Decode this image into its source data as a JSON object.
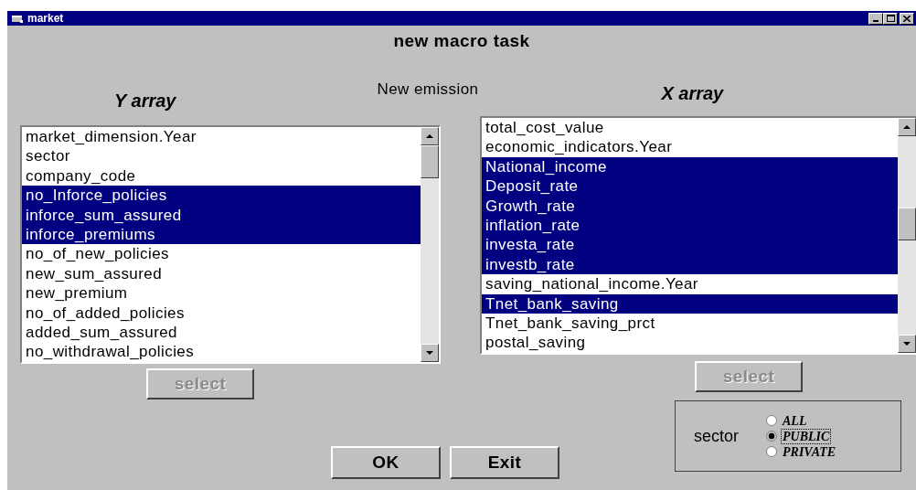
{
  "window": {
    "title": "market"
  },
  "heading": "new macro task",
  "y_array": {
    "label": "Y array",
    "select_button": {
      "label": "select",
      "disabled": true
    },
    "items": [
      {
        "label": "market_dimension.Year",
        "selected": false
      },
      {
        "label": "sector",
        "selected": false
      },
      {
        "label": "company_code",
        "selected": false
      },
      {
        "label": "no_Inforce_policies",
        "selected": true
      },
      {
        "label": "inforce_sum_assured",
        "selected": true
      },
      {
        "label": "inforce_premiums",
        "selected": true
      },
      {
        "label": "no_of_new_policies",
        "selected": false
      },
      {
        "label": "new_sum_assured",
        "selected": false
      },
      {
        "label": "new_premium",
        "selected": false
      },
      {
        "label": "no_of_added_policies",
        "selected": false
      },
      {
        "label": "added_sum_assured",
        "selected": false
      },
      {
        "label": "no_withdrawal_policies",
        "selected": false
      }
    ]
  },
  "new_emission_label": "New emission",
  "x_array": {
    "label": "X array",
    "select_button": {
      "label": "select",
      "disabled": true
    },
    "items": [
      {
        "label": "total_cost_value",
        "selected": false
      },
      {
        "label": "economic_indicators.Year",
        "selected": false
      },
      {
        "label": "National_income",
        "selected": true
      },
      {
        "label": "Deposit_rate",
        "selected": true
      },
      {
        "label": "Growth_rate",
        "selected": true
      },
      {
        "label": "inflation_rate",
        "selected": true
      },
      {
        "label": "investa_rate",
        "selected": true
      },
      {
        "label": "investb_rate",
        "selected": true
      },
      {
        "label": "saving_national_income.Year",
        "selected": false
      },
      {
        "label": "Tnet_bank_saving",
        "selected": true
      },
      {
        "label": "Tnet_bank_saving_prct",
        "selected": false
      },
      {
        "label": "postal_saving",
        "selected": false
      }
    ]
  },
  "sector": {
    "label": "sector",
    "options": [
      {
        "label": "ALL",
        "selected": false
      },
      {
        "label": "PUBLIC",
        "selected": true
      },
      {
        "label": "PRIVATE",
        "selected": false
      }
    ]
  },
  "buttons": [
    {
      "label": "OK",
      "disabled": false
    },
    {
      "label": "Exit",
      "disabled": false
    }
  ]
}
